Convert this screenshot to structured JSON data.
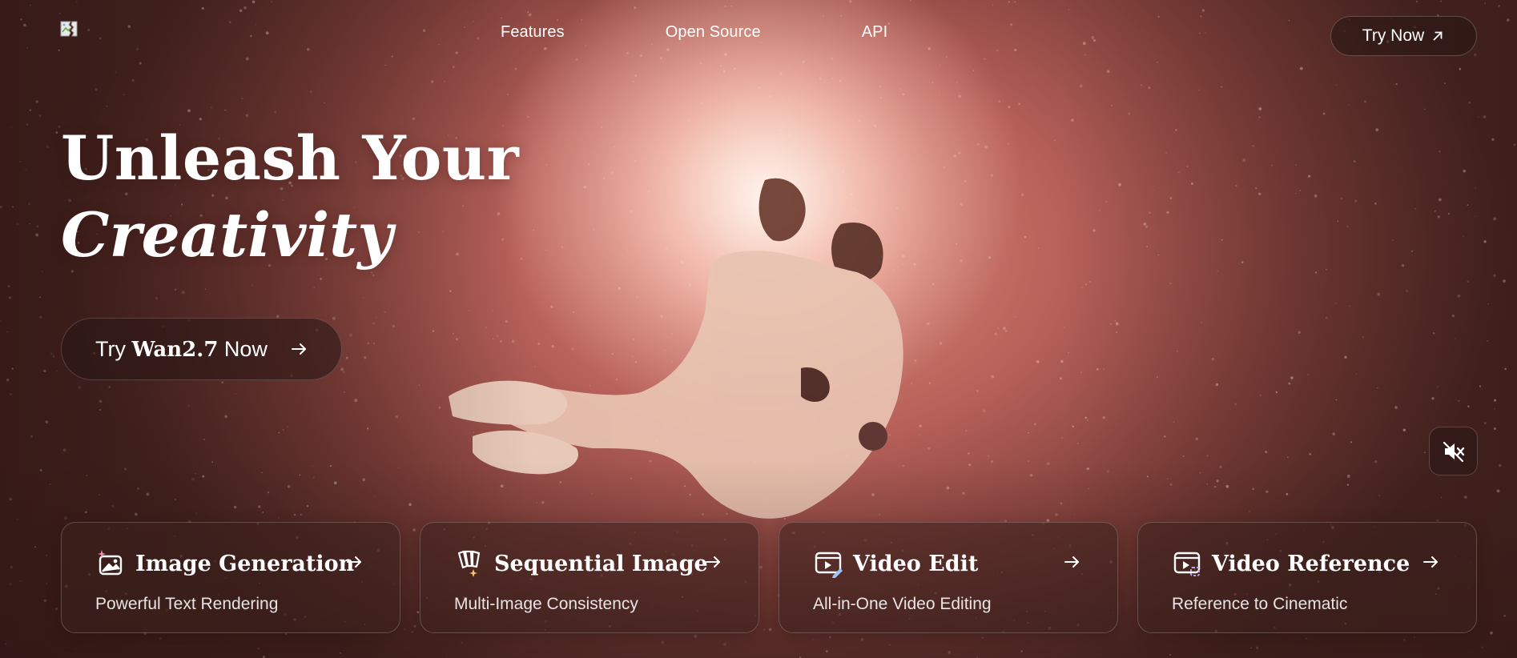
{
  "nav": {
    "links": [
      {
        "label": "Features"
      },
      {
        "label": "Open Source"
      },
      {
        "label": "API"
      }
    ],
    "try_now_label": "Try Now"
  },
  "hero": {
    "title_line1": "Unleash Your",
    "title_line2": "Creativity",
    "cta_prefix": "Try ",
    "cta_brand": "Wan2.7",
    "cta_suffix": " Now"
  },
  "icons": {
    "logo": "broken-image-logo",
    "try_now": "arrow-up-right-icon",
    "cta": "arrow-right-icon",
    "mute": "speaker-muted-icon"
  },
  "cards": [
    {
      "title": "Image Generation",
      "subtitle": "Powerful Text Rendering",
      "icon": "image-sparkle-icon"
    },
    {
      "title": "Sequential Image",
      "subtitle": "Multi-Image Consistency",
      "icon": "multi-image-icon"
    },
    {
      "title": "Video Edit",
      "subtitle": "All-in-One Video Editing",
      "icon": "video-edit-icon"
    },
    {
      "title": "Video Reference",
      "subtitle": "Reference to Cinematic",
      "icon": "video-reference-icon"
    }
  ],
  "colors": {
    "accent_pink": "#f08fb0",
    "background_base": "#4a2622",
    "glow": "#fbe6dc"
  }
}
